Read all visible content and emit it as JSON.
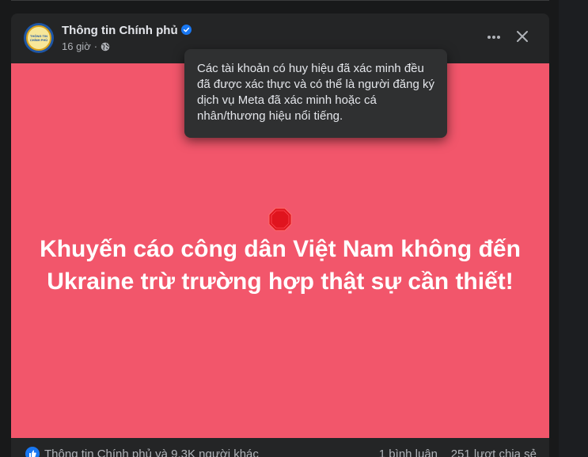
{
  "post": {
    "page_name": "Thông tin Chính phủ",
    "time": "16 giờ",
    "separator": "·",
    "avatar_text_top": "THÔNG TIN",
    "avatar_text_bottom": "CHÍNH PHỦ",
    "headline": "Khuyến cáo công dân Việt Nam không đến Ukraine trừ trường hợp thật sự cần thiết!",
    "banner_color": "#f2566b"
  },
  "tooltip": {
    "text": "Các tài khoản có huy hiệu đã xác minh đều đã được xác thực và có thể là người đăng ký dịch vụ Meta đã xác minh hoặc cá nhân/thương hiệu nổi tiếng."
  },
  "footer": {
    "likes_text": "Thông tin Chính phủ và 9,3K người khác",
    "comments_text": "1 bình luận",
    "shares_text": "251 lượt chia sẻ"
  },
  "icons": {
    "verified": "verified-badge-icon",
    "globe": "globe-icon",
    "more": "more-options-icon",
    "close": "close-icon",
    "stop": "stop-sign-icon",
    "like": "like-icon"
  },
  "colors": {
    "accent": "#1877f2",
    "card": "#242526",
    "background": "#18191a"
  }
}
